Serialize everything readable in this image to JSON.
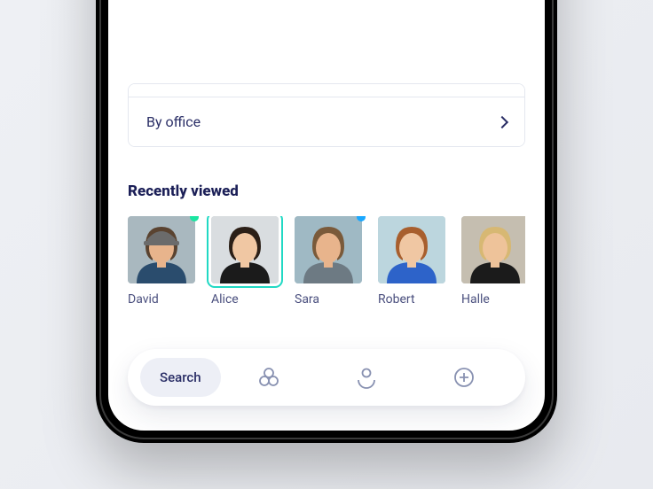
{
  "filter": {
    "byOfficeLabel": "By office"
  },
  "sectionTitle": "Recently viewed",
  "people": [
    {
      "name": "David",
      "status": "green",
      "selected": false,
      "bg": "#a9b8bf",
      "shirt": "#2a4c6d",
      "skin": "#e8b48c",
      "hair": "#5a4330",
      "hat": "#6b6b6b"
    },
    {
      "name": "Alice",
      "status": null,
      "selected": true,
      "bg": "#d9dde0",
      "shirt": "#1b1b1b",
      "skin": "#f0c7a3",
      "hair": "#2b1f17"
    },
    {
      "name": "Sara",
      "status": "blue",
      "selected": false,
      "bg": "#9fb9c4",
      "shirt": "#6d7a83",
      "skin": "#e8b48c",
      "hair": "#7a5a3a"
    },
    {
      "name": "Robert",
      "status": null,
      "selected": false,
      "bg": "#bcd6de",
      "shirt": "#2d63c9",
      "skin": "#f0c7a3",
      "hair": "#a85f2e"
    },
    {
      "name": "Halle",
      "status": null,
      "selected": false,
      "bg": "#c5beb0",
      "shirt": "#1b1b1b",
      "skin": "#eec39a",
      "hair": "#d7b873"
    }
  ],
  "tabs": {
    "searchLabel": "Search"
  }
}
